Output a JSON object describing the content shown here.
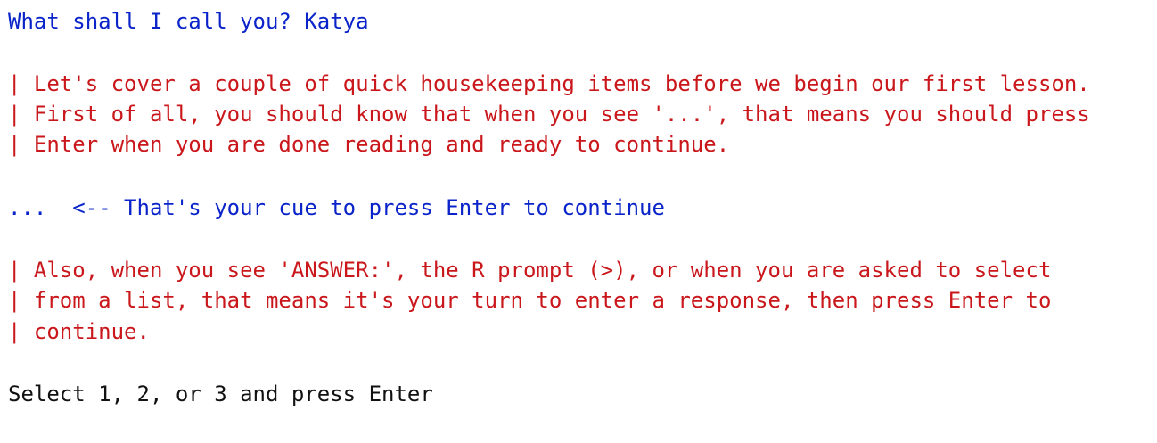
{
  "console": {
    "name_prompt": "What shall I call you? Katya",
    "intro_lines": [
      "| Let's cover a couple of quick housekeeping items before we begin our first lesson.",
      "| First of all, you should know that when you see '...', that means you should press",
      "| Enter when you are done reading and ready to continue."
    ],
    "continue_cue": "...  <-- That's your cue to press Enter to continue",
    "answer_lines": [
      "| Also, when you see 'ANSWER:', the R prompt (>), or when you are asked to select",
      "| from a list, that means it's your turn to enter a response, then press Enter to",
      "| continue."
    ],
    "select_prompt": "Select 1, 2, or 3 and press Enter"
  },
  "colors": {
    "prompt_blue": "#0b24c9",
    "message_red": "#c9171b",
    "text_black": "#111111"
  }
}
